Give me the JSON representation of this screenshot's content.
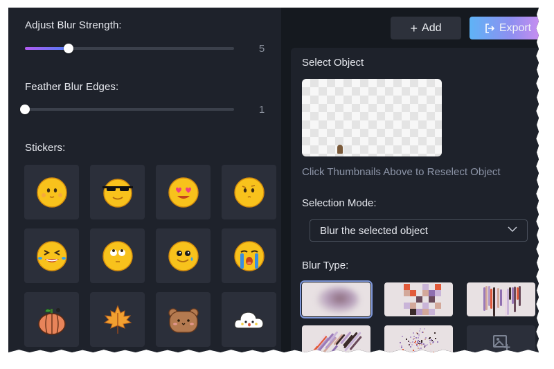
{
  "left_panel": {
    "blur_strength": {
      "label": "Adjust Blur Strength:",
      "value": "5",
      "fill_fraction": 0.21
    },
    "feather_edges": {
      "label": "Feather Blur Edges:",
      "value": "1",
      "fill_fraction": 0.0
    },
    "stickers": {
      "label": "Stickers:",
      "items": [
        {
          "name": "blushing-face"
        },
        {
          "name": "sunglasses-face"
        },
        {
          "name": "heart-eyes-face"
        },
        {
          "name": "confused-face"
        },
        {
          "name": "tears-of-joy-face"
        },
        {
          "name": "eye-roll-face"
        },
        {
          "name": "teary-smile-face"
        },
        {
          "name": "crying-face"
        },
        {
          "name": "pumpkin"
        },
        {
          "name": "maple-leaf"
        },
        {
          "name": "bear-face"
        },
        {
          "name": "cloud-face"
        }
      ]
    }
  },
  "toolbar": {
    "add_label": "Add",
    "add_icon": "plus-icon",
    "export_label": "Export",
    "export_icon": "export-icon"
  },
  "right_panel": {
    "select_object_label": "Select Object",
    "hint": "Click Thumbnails Above to Reselect Object",
    "selection_mode_label": "Selection Mode:",
    "selection_mode_value": "Blur the selected object",
    "blur_type_label": "Blur Type:",
    "blur_types": [
      {
        "name": "gaussian",
        "selected": true
      },
      {
        "name": "mosaic",
        "selected": false
      },
      {
        "name": "vertical-streak",
        "selected": false
      },
      {
        "name": "diagonal-streak",
        "selected": false
      },
      {
        "name": "scatter",
        "selected": false
      },
      {
        "name": "custom-image",
        "selected": false
      }
    ]
  },
  "colors": {
    "accent_gradient_start": "#b25bf2",
    "accent_gradient_end": "#4f7cf4",
    "export_gradient_start": "#5fb3f6",
    "export_gradient_end": "#d38df0"
  }
}
